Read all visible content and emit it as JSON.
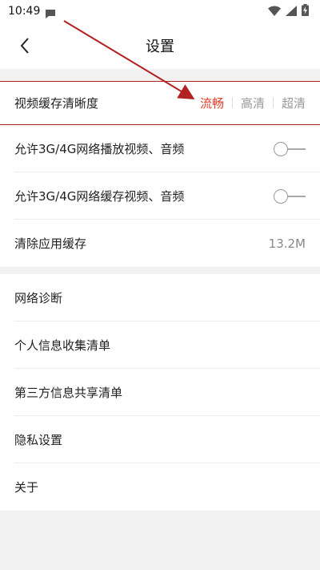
{
  "status_bar": {
    "time": "10:49"
  },
  "header": {
    "title": "设置"
  },
  "video_quality": {
    "label": "视频缓存清晰度",
    "options": [
      "流畅",
      "高清",
      "超清"
    ],
    "selected": "流畅",
    "accent_color": "#e43c2b"
  },
  "settings_group_1": [
    {
      "label": "允许3G/4G网络播放视频、音频",
      "toggle": false
    },
    {
      "label": "允许3G/4G网络缓存视频、音频",
      "toggle": false
    },
    {
      "label": "清除应用缓存",
      "value": "13.2M"
    }
  ],
  "settings_group_2": [
    {
      "label": "网络诊断"
    },
    {
      "label": "个人信息收集清单"
    },
    {
      "label": "第三方信息共享清单"
    },
    {
      "label": "隐私设置"
    },
    {
      "label": "关于"
    }
  ],
  "annotation": {
    "color": "#b22222"
  }
}
